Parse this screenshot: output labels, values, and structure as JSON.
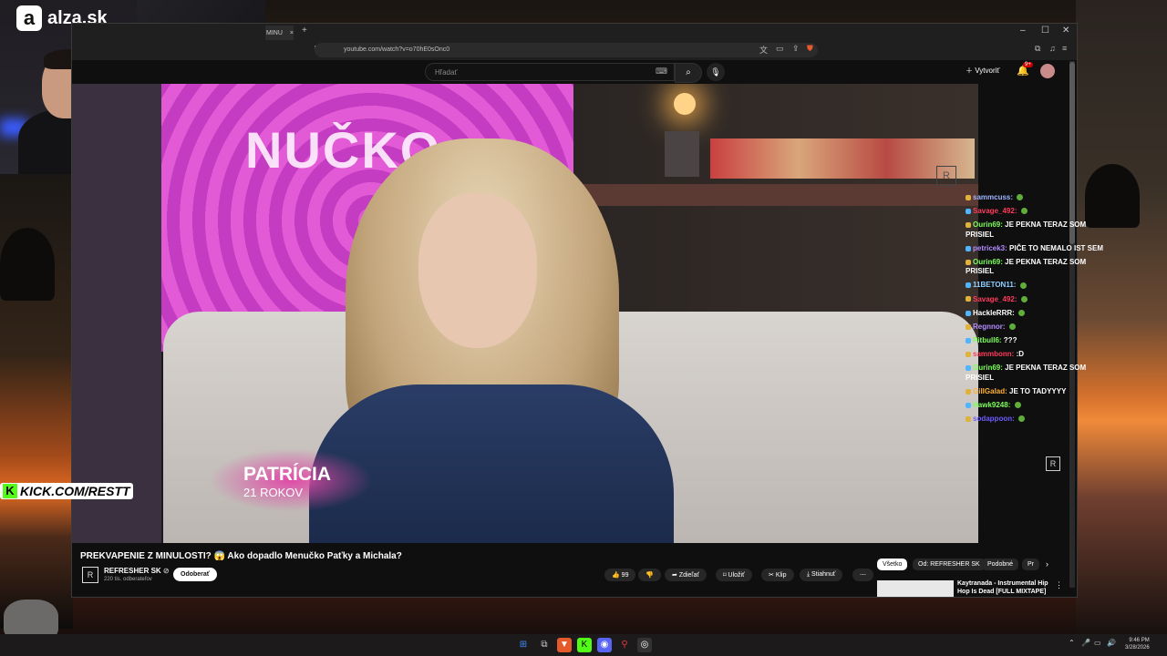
{
  "overlay": {
    "brand": "alza.sk",
    "brand_letter": "a",
    "kick_label": "KICK.COM/RESTT",
    "kick_letter": "K"
  },
  "browser": {
    "tab_title": "MINU",
    "tab_close": "×",
    "new_tab": "+",
    "window_controls": [
      "–",
      "☐",
      "✕"
    ],
    "url": "youtube.com/watch?v=o70hE0sOnc0"
  },
  "youtube": {
    "search_placeholder": "Hľadať",
    "create_label": "Vytvoriť",
    "notification_count": "9+",
    "video": {
      "screen_text": "NUČKO",
      "lower_third_name": "PATRÍCIA",
      "lower_third_age": "21 ROKOV"
    },
    "title": "PREKVAPENIE Z MINULOSTI? 😱 Ako dopadlo Menučko Paťky a Michala?",
    "channel": {
      "name": "REFRESHER SK",
      "verified": "⊘",
      "subscribers": "220 tis. odberateľov",
      "subscribe_label": "Odoberať"
    },
    "actions": {
      "likes": "99",
      "share": "Zdieľať",
      "save": "Uložiť",
      "clip": "Klip",
      "download": "Stiahnuť",
      "more": "⋯"
    },
    "filters": [
      "Všetko",
      "Od: REFRESHER SK",
      "Podobné",
      "Pr"
    ],
    "recommended": {
      "title": "Kaytranada - Instrumental Hip Hop Is Dead [FULL MIXTAPE]"
    }
  },
  "chat": [
    {
      "user": "sammcuss:",
      "color": "#9fb4ff",
      "text": ""
    },
    {
      "user": "Savage_492:",
      "color": "#ff3b5c",
      "text": ""
    },
    {
      "user": "Ourin69:",
      "color": "#7cff5a",
      "text": "JE PEKNA TERAZ SOM PRISIEL"
    },
    {
      "user": "petricek3:",
      "color": "#b48cff",
      "text": "PIČE TO NEMALO IST SEM"
    },
    {
      "user": "Ourin69:",
      "color": "#7cff5a",
      "text": "JE PEKNA TERAZ SOM PRISIEL"
    },
    {
      "user": "11BETON11:",
      "color": "#8fd0ff",
      "text": ""
    },
    {
      "user": "Savage_492:",
      "color": "#ff3b5c",
      "text": ""
    },
    {
      "user": "HackleRRR:",
      "color": "#ffffff",
      "text": ""
    },
    {
      "user": "Regnnor:",
      "color": "#b48cff",
      "text": ""
    },
    {
      "user": "Pitbull6:",
      "color": "#7cff5a",
      "text": "???"
    },
    {
      "user": "sammbonn:",
      "color": "#ff3b5c",
      "text": ":D"
    },
    {
      "user": "Ourin69:",
      "color": "#7cff5a",
      "text": "JE PEKNA TERAZ SOM PRISIEL"
    },
    {
      "user": "GillGalad:",
      "color": "#ffb13b",
      "text": "JE TO TADYYYY"
    },
    {
      "user": "Hawk9248:",
      "color": "#7cff5a",
      "text": ""
    },
    {
      "user": "sodappoon:",
      "color": "#6a5cff",
      "text": ""
    }
  ],
  "taskbar": {
    "time": "9:46 PM",
    "date": "3/28/2026"
  }
}
